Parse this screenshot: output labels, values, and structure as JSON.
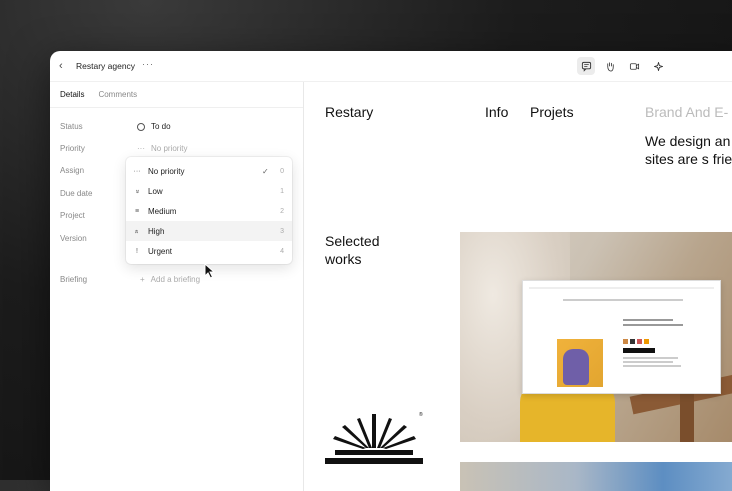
{
  "topbar": {
    "title": "Restary agency",
    "more": "···"
  },
  "panel": {
    "tabs": [
      {
        "label": "Details"
      },
      {
        "label": "Comments"
      }
    ],
    "fields": {
      "status": {
        "label": "Status",
        "value": "To do"
      },
      "priority": {
        "label": "Priority",
        "value": "No priority"
      },
      "assign": {
        "label": "Assign"
      },
      "due_date": {
        "label": "Due date"
      },
      "project": {
        "label": "Project"
      },
      "version": {
        "label": "Version"
      },
      "briefing": {
        "label": "Briefing",
        "placeholder": "Add a briefing"
      }
    },
    "priority_menu": [
      {
        "icon": "···",
        "label": "No priority",
        "key": "0",
        "selected": true
      },
      {
        "icon": "»",
        "label": "Low",
        "key": "1"
      },
      {
        "icon": "≡",
        "label": "Medium",
        "key": "2"
      },
      {
        "icon": "»",
        "label": "High",
        "key": "3"
      },
      {
        "icon": "!",
        "label": "Urgent",
        "key": "4"
      }
    ]
  },
  "site": {
    "logo": "Restary",
    "nav": [
      "Info",
      "Projets",
      "Brand And E-"
    ],
    "description": "We design an websites for e our sites are s friendly, and S",
    "selected_works": "Selected works",
    "reg": "®"
  },
  "icons": {
    "back": "chevron-left-icon",
    "comment": "message-square-icon",
    "hand": "hand-icon",
    "video": "video-icon",
    "sparkle": "sparkle-icon"
  }
}
